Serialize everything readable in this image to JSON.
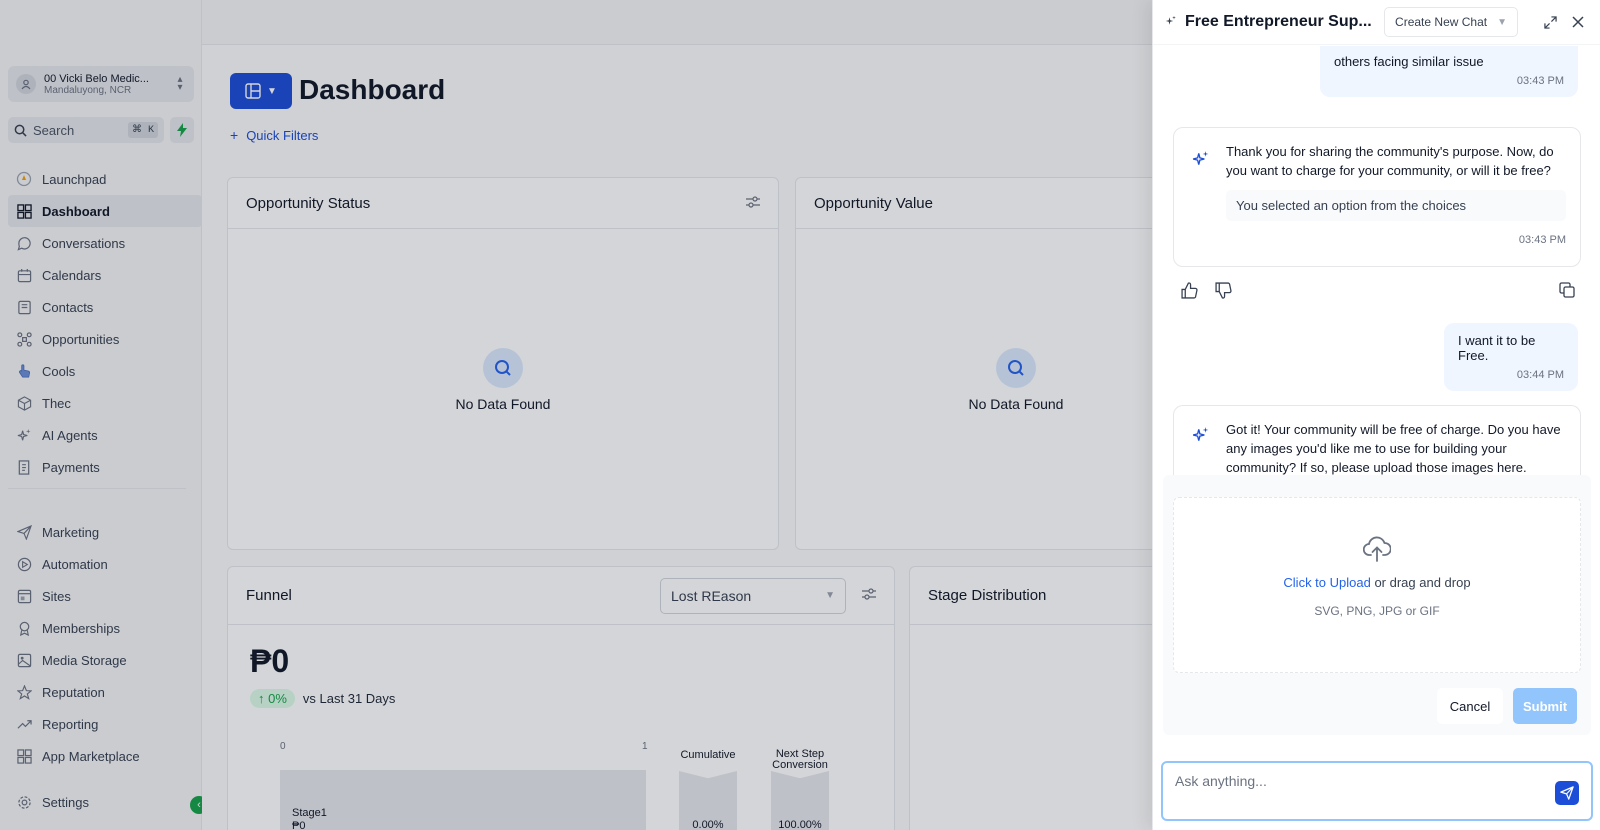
{
  "sidebar": {
    "account": {
      "name": "00 Vicki Belo Medic...",
      "location": "Mandaluyong, NCR"
    },
    "search": {
      "label": "Search",
      "shortcut": "⌘ K"
    },
    "items": [
      {
        "label": "Launchpad",
        "icon": "rocket-icon"
      },
      {
        "label": "Dashboard",
        "icon": "grid-icon",
        "active": true
      },
      {
        "label": "Conversations",
        "icon": "chat-bubble-icon"
      },
      {
        "label": "Calendars",
        "icon": "calendar-icon"
      },
      {
        "label": "Contacts",
        "icon": "contacts-icon"
      },
      {
        "label": "Opportunities",
        "icon": "opportunities-icon"
      },
      {
        "label": "Cools",
        "icon": "hand-pointer-icon"
      },
      {
        "label": "Thec",
        "icon": "cube-icon"
      },
      {
        "label": "AI Agents",
        "icon": "sparkle-icon"
      },
      {
        "label": "Payments",
        "icon": "receipt-icon"
      }
    ],
    "items2": [
      {
        "label": "Marketing",
        "icon": "send-icon"
      },
      {
        "label": "Automation",
        "icon": "automation-icon"
      },
      {
        "label": "Sites",
        "icon": "sites-icon"
      },
      {
        "label": "Memberships",
        "icon": "badge-icon"
      },
      {
        "label": "Media Storage",
        "icon": "image-icon"
      },
      {
        "label": "Reputation",
        "icon": "star-icon"
      },
      {
        "label": "Reporting",
        "icon": "trend-icon"
      },
      {
        "label": "App Marketplace",
        "icon": "apps-icon"
      }
    ],
    "settings": "Settings"
  },
  "main": {
    "title": "Dashboard",
    "quick_filters": "Quick Filters",
    "cards": {
      "opportunity_status": "Opportunity Status",
      "opportunity_value": "Opportunity Value",
      "empty": "No Data Found",
      "funnel": "Funnel",
      "funnel_select": "Lost REason",
      "stage_distribution": "Stage Distribution"
    },
    "funnel": {
      "amount": "₱0",
      "delta": "0%",
      "delta_label": "vs Last 31 Days",
      "axis_min": "0",
      "axis_max": "1",
      "cumulative": "Cumulative",
      "next_step": "Next Step Conversion",
      "stage_name": "Stage1",
      "stage_value": "₱0",
      "cumulative_value": "0.00%",
      "next_step_value": "100.00%"
    }
  },
  "chat": {
    "title": "Free Entrepreneur Sup...",
    "new_chat": "Create New Chat",
    "messages": {
      "user1": "others facing similar issue",
      "user1_time": "03:43 PM",
      "ai1": "Thank you for sharing the community's purpose. Now, do you want to charge for your community, or will it be free?",
      "ai1_choice": "You selected an option from the choices",
      "ai1_time": "03:43 PM",
      "user2": "I want it to be Free.",
      "user2_time": "03:44 PM",
      "ai2": "Got it! Your community will be free of charge. Do you have any images you'd like me to use for building your community? If so, please upload those images here."
    },
    "upload": {
      "link": "Click to Upload",
      "rest": " or drag and drop",
      "formats": "SVG, PNG, JPG or GIF",
      "cancel": "Cancel",
      "submit": "Submit"
    },
    "ask_placeholder": "Ask anything..."
  }
}
